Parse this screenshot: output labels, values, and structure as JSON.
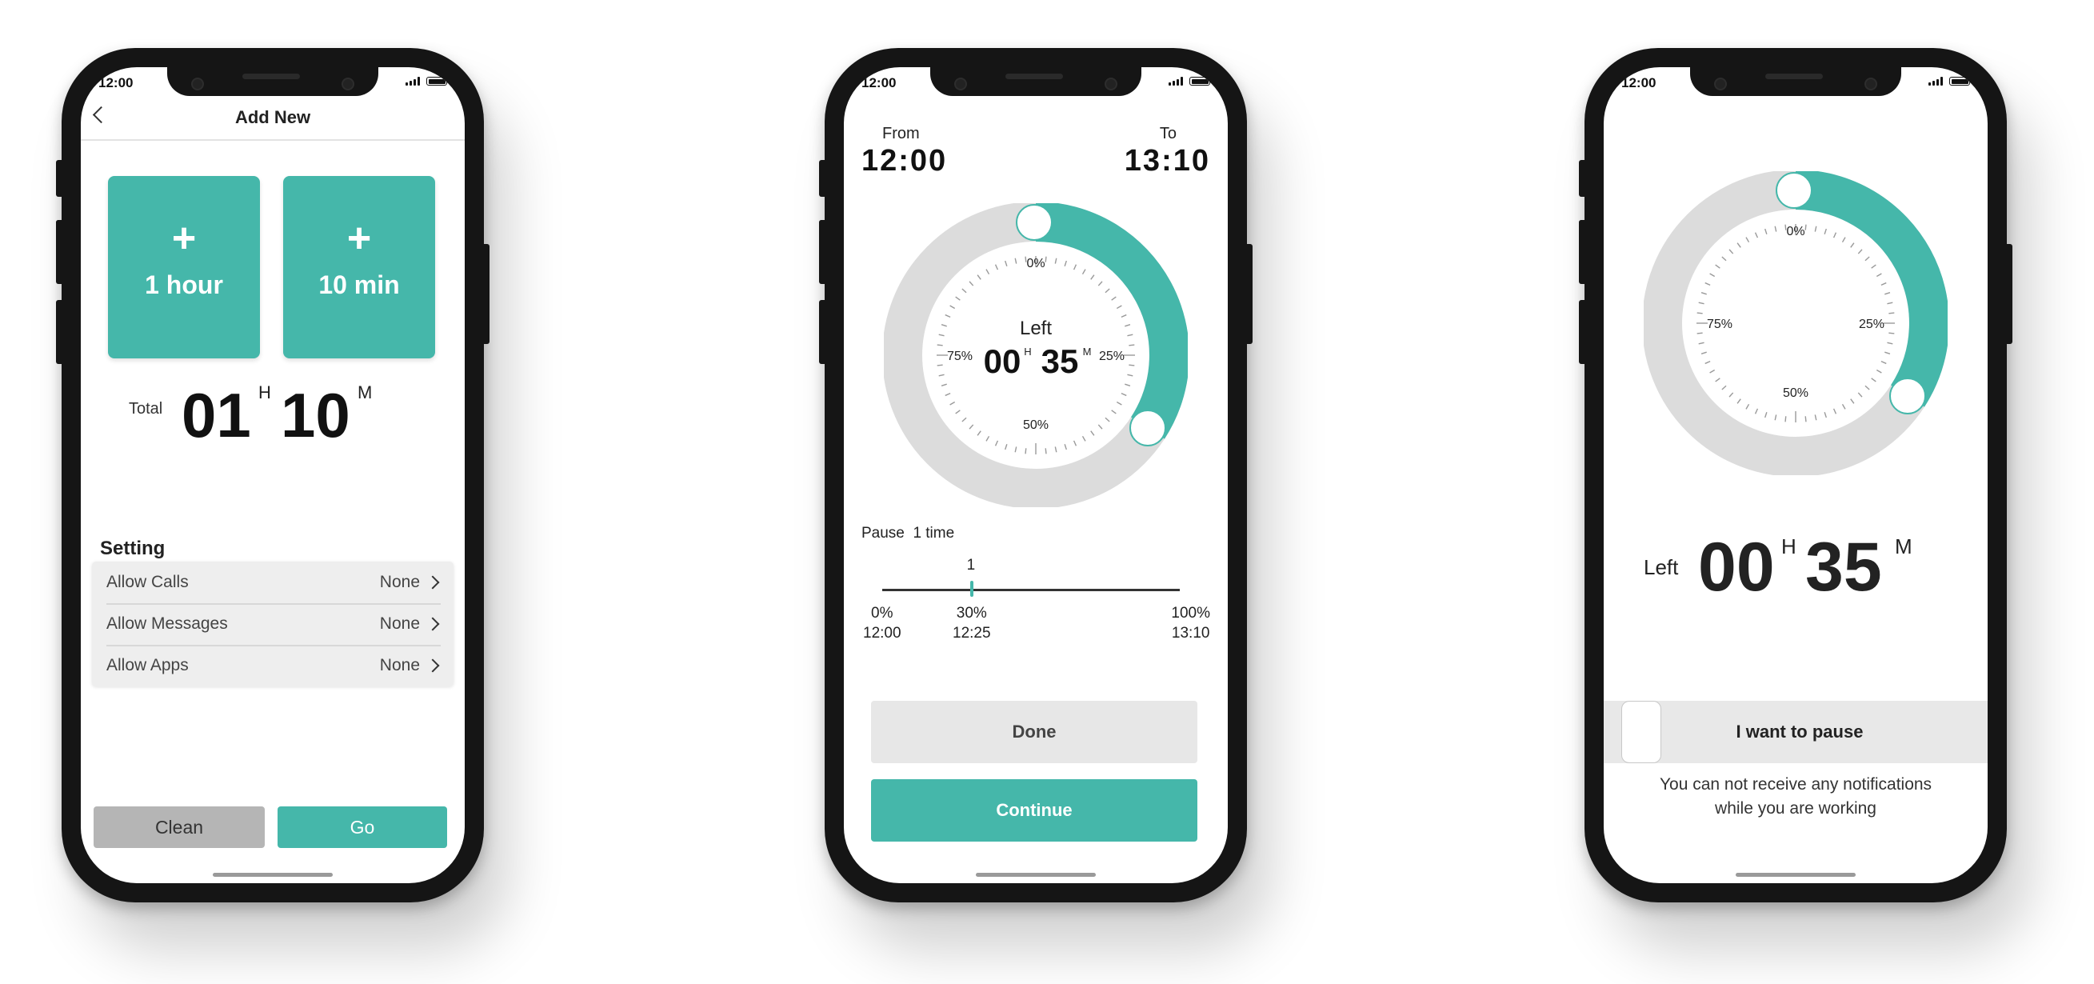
{
  "status": {
    "time": "12:00"
  },
  "screen1": {
    "title": "Add New",
    "tiles": [
      {
        "plus": "+",
        "label": "1 hour"
      },
      {
        "plus": "+",
        "label": "10 min"
      }
    ],
    "total": {
      "label": "Total",
      "hours": "01",
      "h_unit": "H",
      "minutes": "10",
      "m_unit": "M"
    },
    "setting_label": "Setting",
    "settings": [
      {
        "label": "Allow Calls",
        "value": "None"
      },
      {
        "label": "Allow Messages",
        "value": "None"
      },
      {
        "label": "Allow Apps",
        "value": "None"
      }
    ],
    "clean_label": "Clean",
    "go_label": "Go"
  },
  "screen2": {
    "from_label": "From",
    "from_time": "12:00",
    "to_label": "To",
    "to_time": "13:10",
    "dial": {
      "p0": "0%",
      "p25": "25%",
      "p50": "50%",
      "p75": "75%",
      "left_label": "Left",
      "hours": "00",
      "h_unit": "H",
      "minutes": "35",
      "m_unit": "M"
    },
    "pause_label": "Pause",
    "pause_count": "1 time",
    "timeline": {
      "marker_count": "1",
      "marker_position": 0.3,
      "start_pct": "0%",
      "start_time": "12:00",
      "mid_pct": "30%",
      "mid_time": "12:25",
      "end_pct": "100%",
      "end_time": "13:10"
    },
    "done_label": "Done",
    "continue_label": "Continue"
  },
  "screen3": {
    "dial": {
      "p0": "0%",
      "p25": "25%",
      "p50": "50%",
      "p75": "75%"
    },
    "left_label": "Left",
    "hours": "00",
    "h_unit": "H",
    "minutes": "35",
    "m_unit": "M",
    "pause_label": "I want to pause",
    "note_line1": "You can not receive any notifications",
    "note_line2": "while you are working"
  },
  "colors": {
    "accent": "#45b7aa",
    "ring": "#dcdcdc",
    "button_gray": "#b5b5b5"
  }
}
